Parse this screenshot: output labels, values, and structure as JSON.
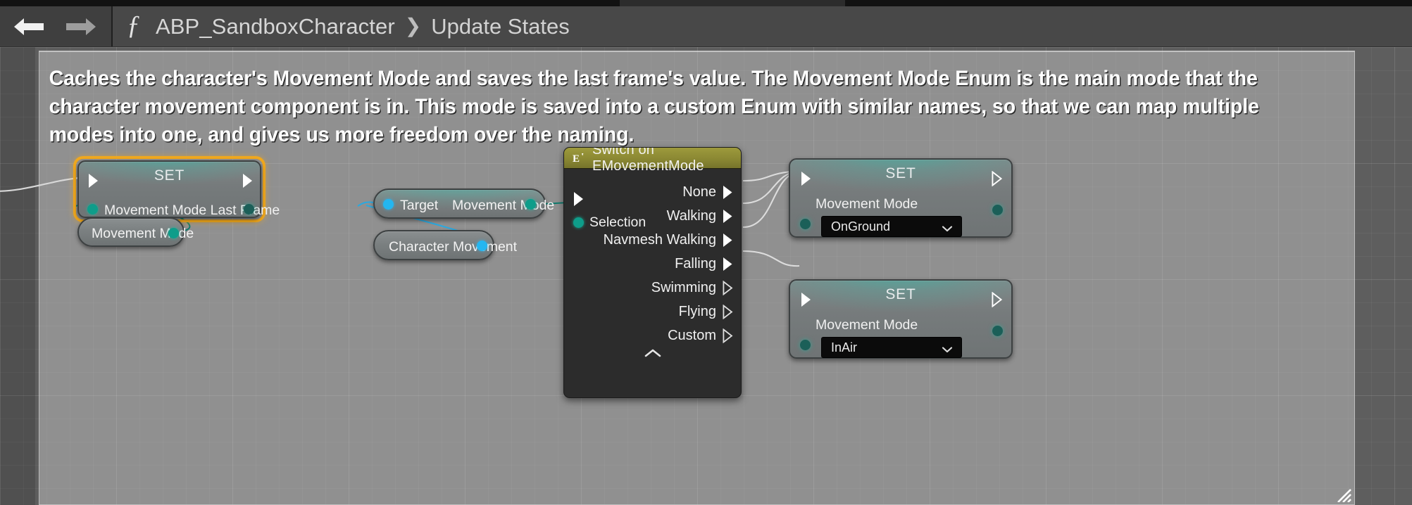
{
  "window": {
    "background_color": "#1b1b1b",
    "graph_background_color": "#5e5e5e"
  },
  "toolbar": {
    "back_icon": "arrow-left-icon",
    "forward_icon": "arrow-right-icon",
    "function_icon": "fx-icon",
    "function_glyph": "ƒ"
  },
  "breadcrumb": {
    "root": "ABP_SandboxCharacter",
    "separator": "❯",
    "leaf": "Update States"
  },
  "comment": {
    "text": "Caches the character's Movement Mode and saves the last frame's value. The Movement Mode Enum is the main mode that the character movement component is in. This mode is saved into a custom Enum with similar names, so that we can map multiple modes into one, and gives us more freedom over the naming.",
    "resize_icon": "resize-handle-icon",
    "color": "#d7d7d7"
  },
  "nodes": {
    "set_last_frame": {
      "title": "SET",
      "selected": true,
      "selection_color": "#f0a81e",
      "exec_in_icon": "exec-in-arrow-icon",
      "exec_out_icon": "exec-out-arrow-icon",
      "property_label": "Movement Mode Last Frame",
      "pin_color": "#0e9d8a"
    },
    "get_movement_mode_var": {
      "label": "Movement Mode",
      "pin_color": "#0e9d8a"
    },
    "get_movement_mode_fn": {
      "input_label": "Target",
      "input_pin_color": "#24b6f0",
      "output_label": "Movement Mode",
      "output_pin_color": "#0e9d8a"
    },
    "character_movement": {
      "label": "Character Movement",
      "pin_color": "#24b6f0"
    },
    "switch": {
      "title": "Switch on EMovementMode",
      "icon": "enum-icon",
      "icon_glyph": "E",
      "header_color": "#8b8833",
      "selection_label": "Selection",
      "selection_pin_color": "#0e9d8a",
      "exec_in_icon": "exec-in-arrow-icon",
      "collapse_icon": "chevron-up-icon",
      "outputs": [
        {
          "label": "None",
          "connected": true
        },
        {
          "label": "Walking",
          "connected": true
        },
        {
          "label": "Navmesh Walking",
          "connected": true
        },
        {
          "label": "Falling",
          "connected": true
        },
        {
          "label": "Swimming",
          "connected": false
        },
        {
          "label": "Flying",
          "connected": false
        },
        {
          "label": "Custom",
          "connected": false
        }
      ]
    },
    "set_on_ground": {
      "title": "SET",
      "property_label": "Movement Mode",
      "value": "OnGround",
      "dropdown_icon": "chevron-down-icon",
      "pin_color": "#0e9d8a"
    },
    "set_in_air": {
      "title": "SET",
      "property_label": "Movement Mode",
      "value": "InAir",
      "dropdown_icon": "chevron-down-icon",
      "pin_color": "#0e9d8a"
    }
  }
}
